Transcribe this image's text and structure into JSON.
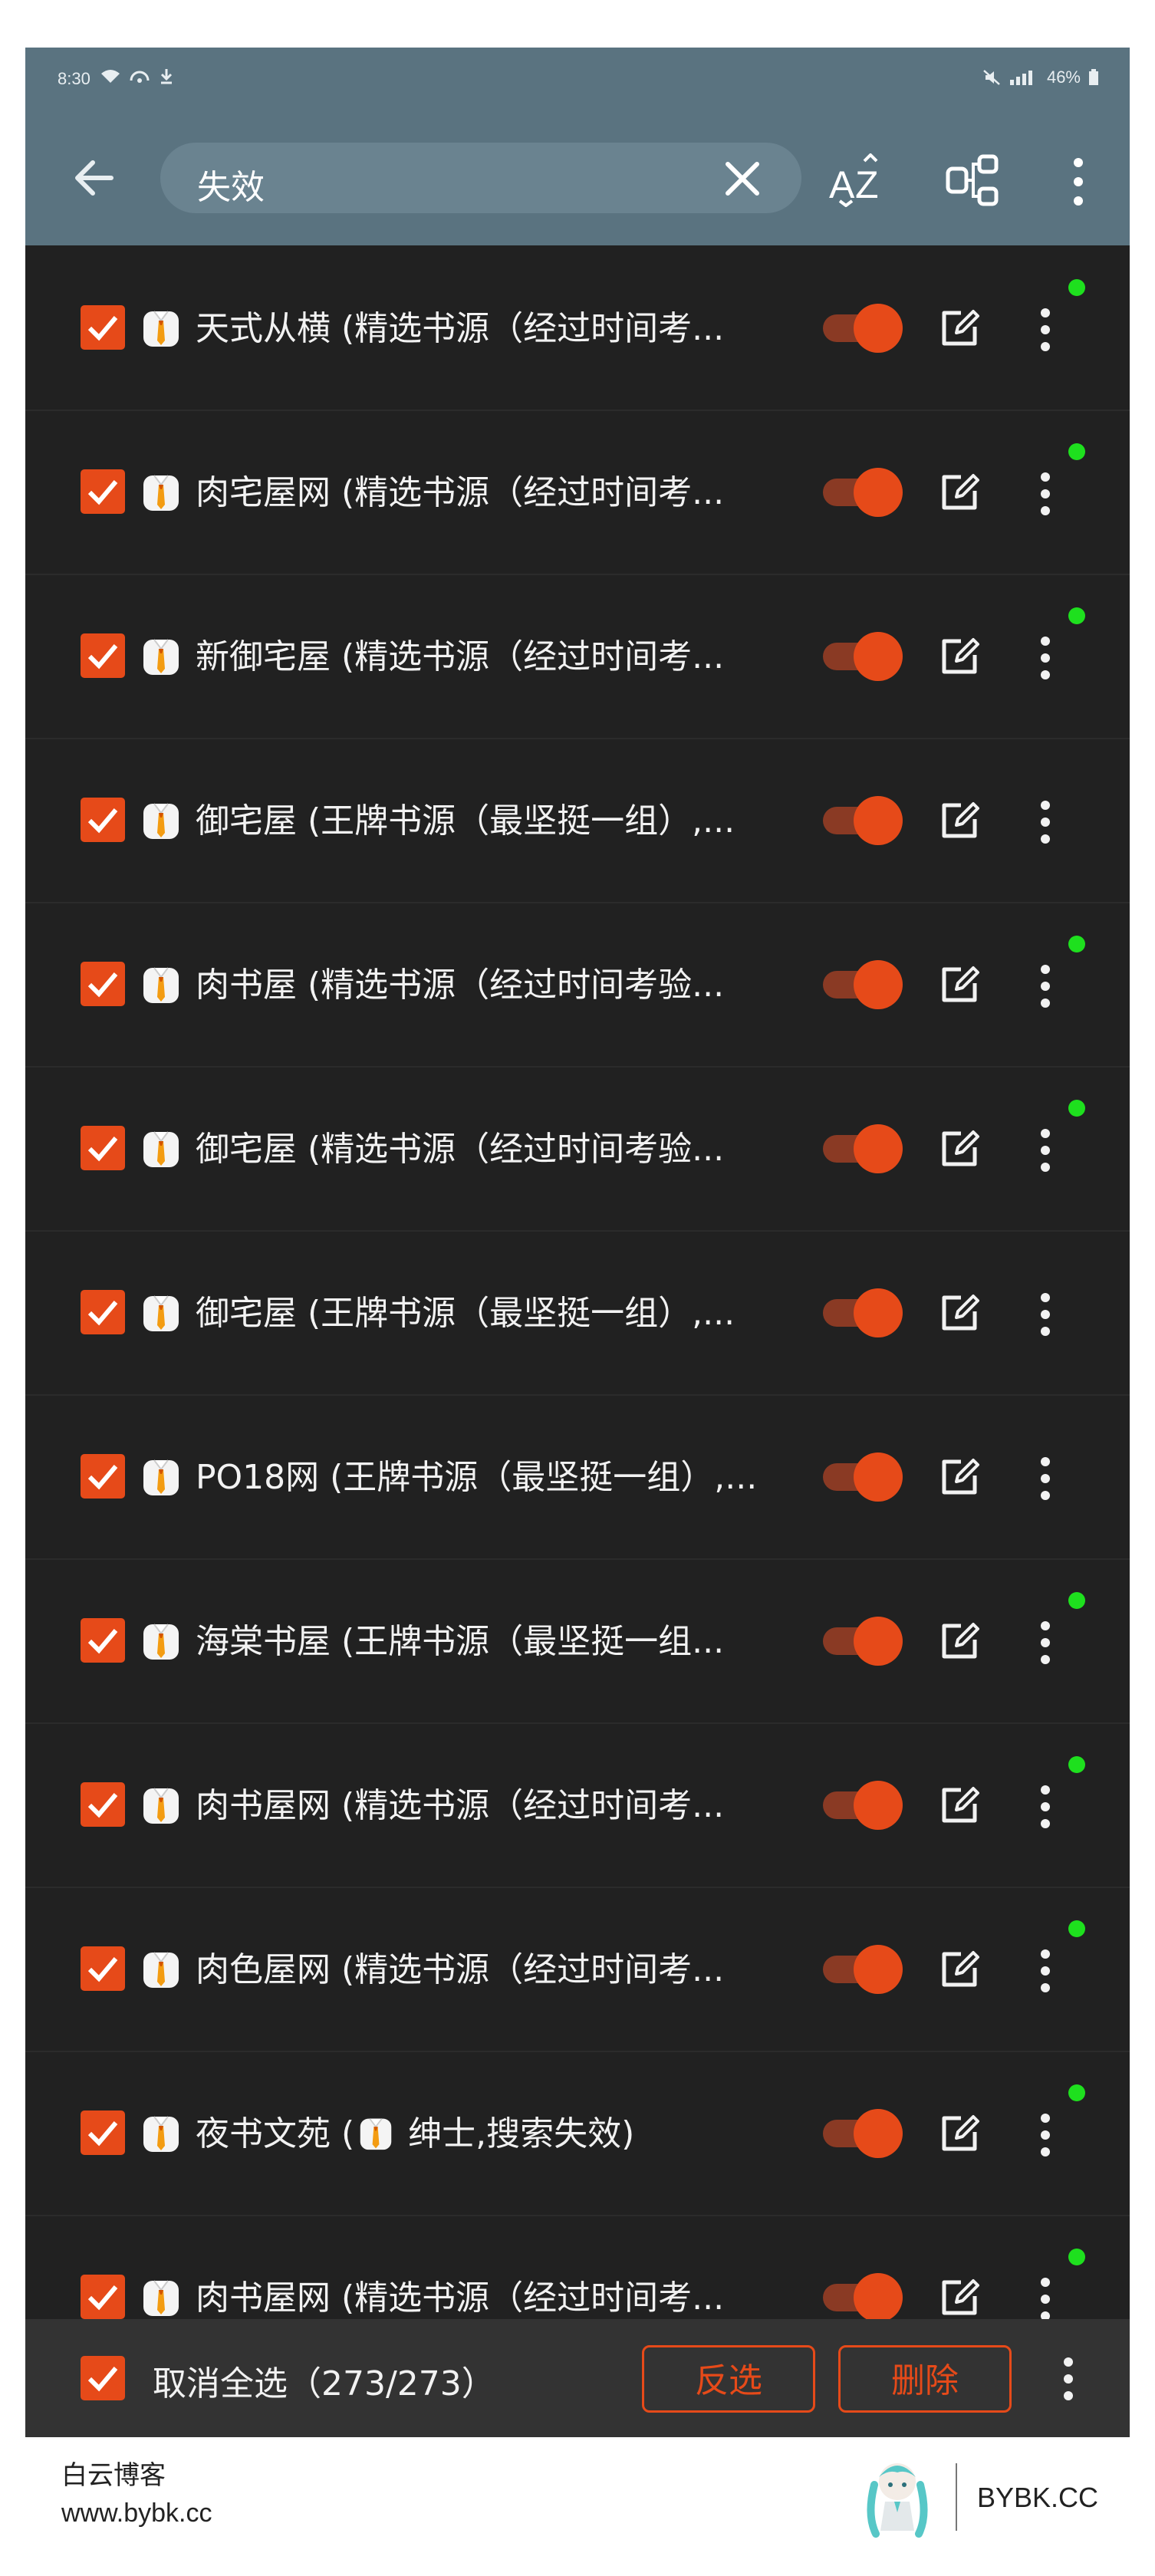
{
  "status_bar": {
    "time": "8:30",
    "battery": "46%"
  },
  "header": {
    "search_query": "失效",
    "sort_icon": "sort-az-icon",
    "group_icon": "group-icon"
  },
  "rows": [
    {
      "name": "天式从横 (精选书源（经过时间考...",
      "enabled": true,
      "dot": true
    },
    {
      "name": "肉宅屋网 (精选书源（经过时间考...",
      "enabled": true,
      "dot": true
    },
    {
      "name": "新御宅屋 (精选书源（经过时间考...",
      "enabled": true,
      "dot": true
    },
    {
      "name": "御宅屋 (王牌书源（最坚挺一组）,...",
      "enabled": true,
      "dot": false
    },
    {
      "name": "肉书屋 (精选书源（经过时间考验...",
      "enabled": true,
      "dot": true
    },
    {
      "name": "御宅屋 (精选书源（经过时间考验...",
      "enabled": true,
      "dot": true
    },
    {
      "name": "御宅屋 (王牌书源（最坚挺一组）,...",
      "enabled": true,
      "dot": false
    },
    {
      "name": "PO18网 (王牌书源（最坚挺一组）,...",
      "enabled": true,
      "dot": false
    },
    {
      "name": "海棠书屋 (王牌书源（最坚挺一组...",
      "enabled": true,
      "dot": true
    },
    {
      "name": "肉书屋网 (精选书源（经过时间考...",
      "enabled": true,
      "dot": true
    },
    {
      "name": "肉色屋网 (精选书源（经过时间考...",
      "enabled": true,
      "dot": true
    },
    {
      "name_prefix": "夜书文苑 (",
      "name_suffix": " 绅士,搜索失效)",
      "enabled": true,
      "dot": true
    },
    {
      "name": "肉书屋网 (精选书源（经过时间考...",
      "enabled": true,
      "dot": true
    }
  ],
  "bottom_bar": {
    "select_label": "取消全选（273/273）",
    "invert_label": "反选",
    "delete_label": "删除"
  },
  "footer": {
    "blog_name": "白云博客",
    "blog_url": "www.bybk.cc",
    "brand": "BYBK.CC"
  },
  "colors": {
    "accent": "#e64a19",
    "appbar": "#5a7380",
    "background": "#212121",
    "dot": "#1ee01e"
  }
}
